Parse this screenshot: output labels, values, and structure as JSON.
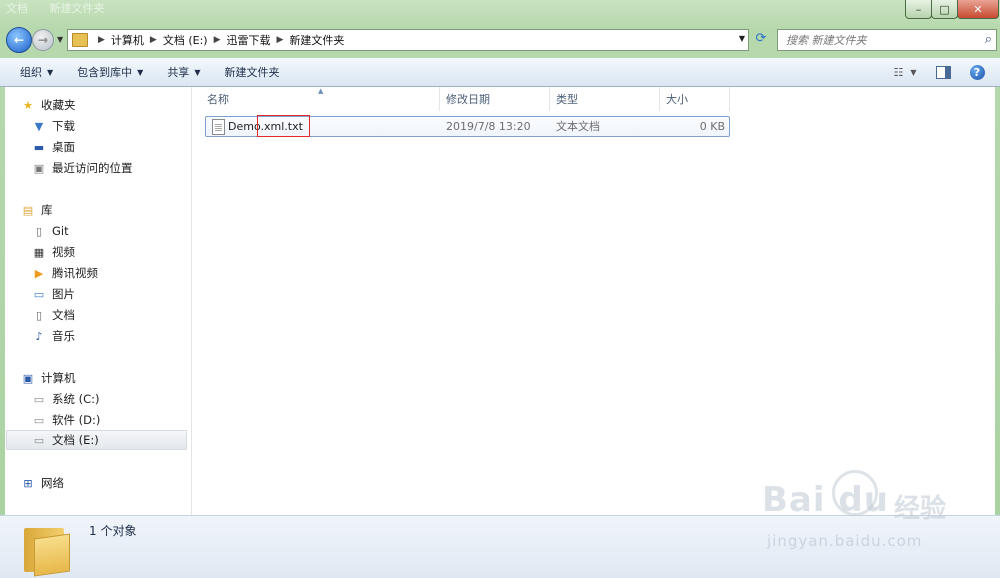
{
  "window": {
    "ghost_title": [
      "文档",
      "新建文件夹"
    ],
    "controls": {
      "minimize": "–",
      "maximize": "□",
      "close": "✕"
    }
  },
  "address": {
    "crumbs": [
      "计算机",
      "文档 (E:)",
      "迅雷下载",
      "新建文件夹"
    ]
  },
  "search": {
    "placeholder": "搜索 新建文件夹"
  },
  "toolbar": {
    "organize": "组织",
    "include_in_library": "包含到库中",
    "share": "共享",
    "new_folder": "新建文件夹"
  },
  "nav": {
    "favorites": "收藏夹",
    "downloads": "下载",
    "desktop": "桌面",
    "recent": "最近访问的位置",
    "libraries": "库",
    "git": "Git",
    "videos": "视频",
    "tencent_video": "腾讯视频",
    "pictures": "图片",
    "documents": "文档",
    "music": "音乐",
    "computer": "计算机",
    "drive_c": "系统 (C:)",
    "drive_d": "软件 (D:)",
    "drive_e": "文档 (E:)",
    "network": "网络"
  },
  "columns": {
    "name": "名称",
    "modified": "修改日期",
    "type": "类型",
    "size": "大小"
  },
  "files": [
    {
      "name": "Demo.xml.txt",
      "modified": "2019/7/8 13:20",
      "type": "文本文档",
      "size": "0 KB"
    }
  ],
  "details": {
    "count": "1 个对象"
  },
  "watermark": {
    "brand": "Bai du",
    "cn": "经验",
    "url": "jingyan.baidu.com"
  },
  "colors": {
    "window_frame": "#b6d8ad",
    "toolbar": "#dbe6f2",
    "selection_border": "#7da2ce",
    "highlight_box": "#e22a2a"
  }
}
